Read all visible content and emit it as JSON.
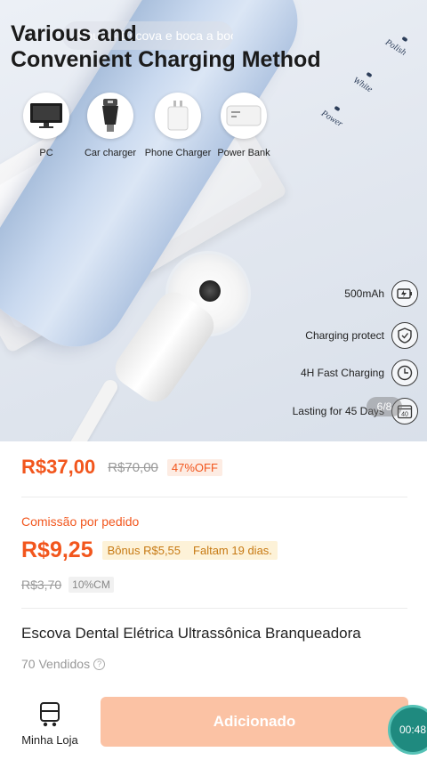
{
  "image": {
    "title_line1": "Various and",
    "title_line2": "Convenient Charging Method",
    "album_overlay": "Álbum · Escova e boca a boca",
    "mode_labels": [
      "Polish",
      "White",
      "Power"
    ],
    "charging_options": [
      {
        "label": "PC",
        "icon": "pc-monitor-icon"
      },
      {
        "label": "Car charger",
        "icon": "car-charger-icon"
      },
      {
        "label": "Phone Charger",
        "icon": "phone-charger-icon"
      },
      {
        "label": "Power Bank",
        "icon": "power-bank-icon"
      }
    ],
    "features": [
      {
        "label": "500mAh",
        "icon": "battery-icon"
      },
      {
        "label": "Charging protect",
        "icon": "shield-icon"
      },
      {
        "label": "4H Fast Charging",
        "icon": "clock-icon"
      },
      {
        "label": "Lasting  for 45 Days",
        "icon": "calendar-icon",
        "icon_text": "40"
      }
    ],
    "page_indicator": "6/8"
  },
  "pricing": {
    "price": "R$37,00",
    "original_price": "R$70,00",
    "discount": "47%OFF",
    "commission_label": "Comissão por pedido",
    "commission_price": "R$9,25",
    "bonus": "Bônus R$5,55",
    "bonus_remaining": "Faltam 19 dias.",
    "commission_original": "R$3,70",
    "commission_rate": "10%CM"
  },
  "product": {
    "name": "Escova Dental Elétrica Ultrassônica Branqueadora",
    "sold": "70 Vendidos"
  },
  "bottom_bar": {
    "store_label": "Minha Loja",
    "added_label": "Adicionado",
    "timer": "00:48"
  },
  "colors": {
    "accent": "#f2561d",
    "bonus": "#c77a14",
    "added_button": "#fbc2a4",
    "timer_bubble": "#1f8a7f"
  }
}
